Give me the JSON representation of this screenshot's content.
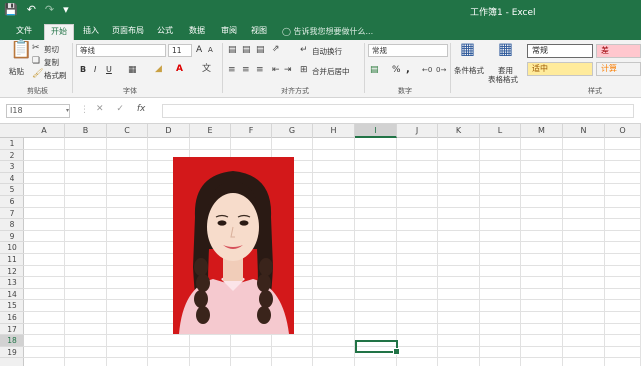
{
  "app": {
    "title": "工作簿1 - Excel",
    "quick_access": [
      "save-icon",
      "undo-icon",
      "redo-icon",
      "customize-icon"
    ]
  },
  "tabs": [
    {
      "label": "文件",
      "active": false
    },
    {
      "label": "开始",
      "active": true
    },
    {
      "label": "插入",
      "active": false
    },
    {
      "label": "页面布局",
      "active": false
    },
    {
      "label": "公式",
      "active": false
    },
    {
      "label": "数据",
      "active": false
    },
    {
      "label": "审阅",
      "active": false
    },
    {
      "label": "视图",
      "active": false
    }
  ],
  "tell_me": "告诉我您想要做什么...",
  "ribbon": {
    "clipboard": {
      "paste": "粘贴",
      "cut": "剪切",
      "copy": "复制",
      "format_painter": "格式刷",
      "label": "剪贴板"
    },
    "font": {
      "name": "等线",
      "size": "11",
      "grow": "A",
      "shrink": "A",
      "bold": "B",
      "italic": "I",
      "underline": "U",
      "label": "字体"
    },
    "alignment": {
      "wrap": "自动换行",
      "merge": "合并后居中",
      "label": "对齐方式"
    },
    "number": {
      "format": "常规",
      "percent": "%",
      "comma": ",",
      "label": "数字"
    },
    "styles": {
      "conditional": "条件格式",
      "table": "套用",
      "table2": "表格格式",
      "cells": [
        {
          "label": "常规",
          "bg": "#ffffff",
          "fg": "#222222"
        },
        {
          "label": "差",
          "bg": "#ffc7ce",
          "fg": "#9c0006"
        },
        {
          "label": "适中",
          "bg": "#ffeb9c",
          "fg": "#9c5700"
        },
        {
          "label": "计算",
          "bg": "#f2f2f2",
          "fg": "#fa7d00"
        }
      ],
      "label": "样式"
    }
  },
  "formula_bar": {
    "name_box": "I18",
    "fx": "fx",
    "value": ""
  },
  "grid": {
    "columns": [
      "A",
      "B",
      "C",
      "D",
      "E",
      "F",
      "G",
      "H",
      "I",
      "J",
      "K",
      "L",
      "M",
      "N",
      "O"
    ],
    "rows": [
      "1",
      "2",
      "3",
      "4",
      "5",
      "6",
      "7",
      "8",
      "9",
      "10",
      "11",
      "12",
      "13",
      "14",
      "15",
      "16",
      "17",
      "18",
      "19"
    ],
    "selected_column": "I",
    "selected_row": "18"
  },
  "colors": {
    "accent": "#217346",
    "photo_background": "#d3181a"
  }
}
